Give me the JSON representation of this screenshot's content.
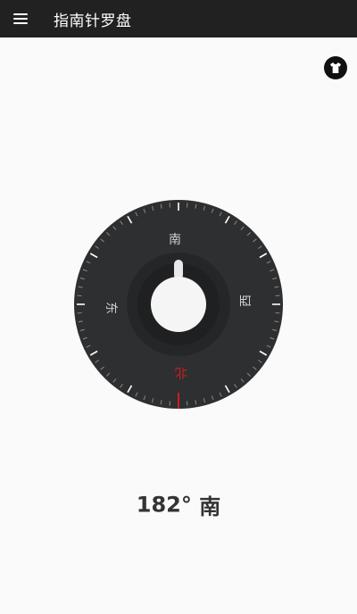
{
  "app_bar": {
    "title": "指南针罗盘",
    "menu_icon": "hamburger-menu-icon"
  },
  "toolbar": {
    "skin_icon": "tshirt-icon"
  },
  "compass": {
    "directions": {
      "north": "北",
      "south": "南",
      "east": "东",
      "west": "西"
    },
    "colors": {
      "dial": "#2e2f31",
      "inner": "#222325",
      "tick": "#8a8a8a",
      "major_tick": "#ffffff",
      "north_accent": "#cc1f1f",
      "label": "#cfcfcf",
      "knob": "#f5f5f5"
    }
  },
  "reading": {
    "degrees": "182°",
    "direction": "南"
  }
}
